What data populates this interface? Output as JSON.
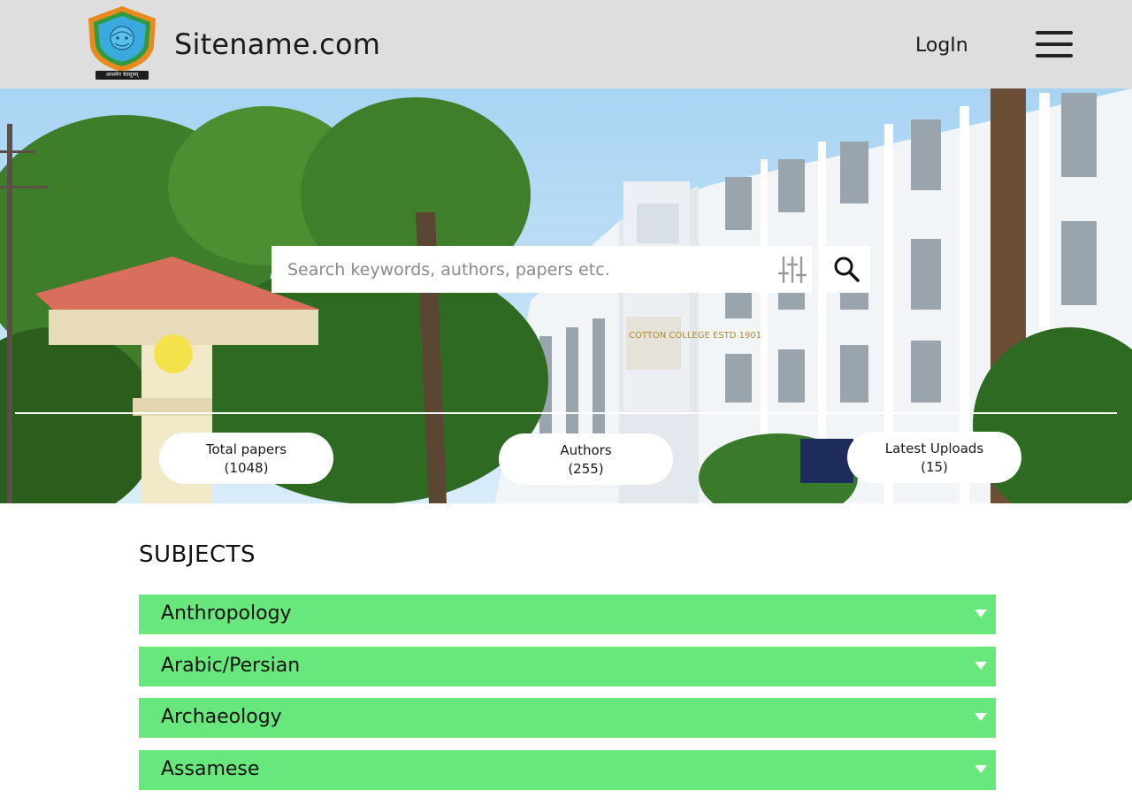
{
  "header": {
    "logo_motto": "आश्रमेन वेदसूत्रम्",
    "site_name": "Sitename.com",
    "login_label": "LogIn",
    "menu_icon": "hamburger-menu-icon"
  },
  "hero": {
    "building_sign": "COTTON COLLEGE ESTD 1901",
    "search": {
      "placeholder": "Search keywords, authors, papers etc.",
      "filter_icon": "sliders-filter-icon",
      "search_icon": "magnifier-search-icon"
    },
    "stats": [
      {
        "label": "Total papers",
        "count": "(1048)"
      },
      {
        "label": "Authors",
        "count": "(255)"
      },
      {
        "label": "Latest Uploads",
        "count": "(15)"
      }
    ]
  },
  "subjects": {
    "title": "SUBJECTS",
    "items": [
      {
        "name": "Anthropology"
      },
      {
        "name": "Arabic/Persian"
      },
      {
        "name": "Archaeology"
      },
      {
        "name": "Assamese"
      }
    ],
    "row_color": "#68e87c",
    "expand_icon": "caret-down-icon"
  },
  "colors": {
    "header_bg": "#dedede",
    "accent_green": "#68e87c"
  }
}
